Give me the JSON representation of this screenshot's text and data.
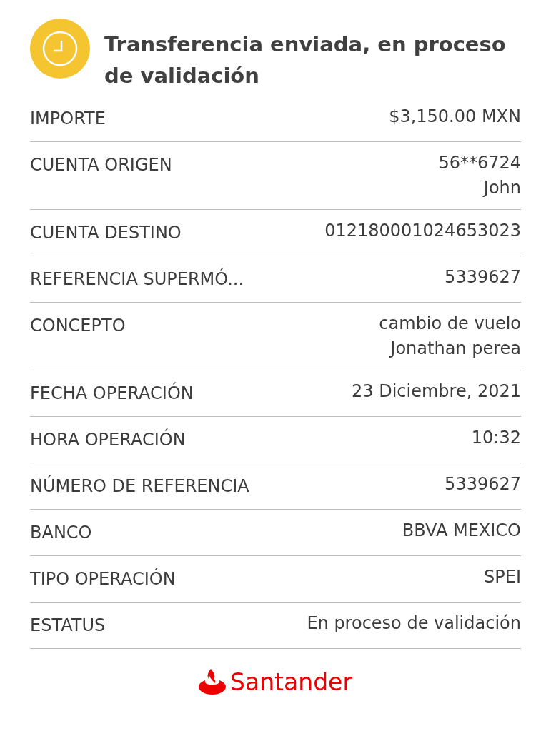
{
  "header": {
    "title": "Transferencia enviada, en proceso de validación"
  },
  "rows": [
    {
      "label": "IMPORTE",
      "values": [
        "$3,150.00 MXN"
      ]
    },
    {
      "label": "CUENTA ORIGEN",
      "values": [
        "56**6724",
        "John"
      ]
    },
    {
      "label": "CUENTA DESTINO",
      "values": [
        "012180001024653023"
      ]
    },
    {
      "label": "REFERENCIA SUPERMÓ...",
      "values": [
        "5339627"
      ]
    },
    {
      "label": "CONCEPTO",
      "values": [
        "cambio de vuelo",
        "Jonathan perea"
      ]
    },
    {
      "label": "FECHA OPERACIÓN",
      "values": [
        "23 Diciembre, 2021"
      ]
    },
    {
      "label": "HORA OPERACIÓN",
      "values": [
        "10:32"
      ]
    },
    {
      "label": "NÚMERO DE REFERENCIA",
      "values": [
        "5339627"
      ]
    },
    {
      "label": "BANCO",
      "values": [
        "BBVA MEXICO"
      ]
    },
    {
      "label": "TIPO OPERACIÓN",
      "values": [
        "SPEI"
      ]
    },
    {
      "label": "ESTATUS",
      "values": [
        "En proceso de validación"
      ]
    }
  ],
  "footer": {
    "brand": "Santander"
  }
}
